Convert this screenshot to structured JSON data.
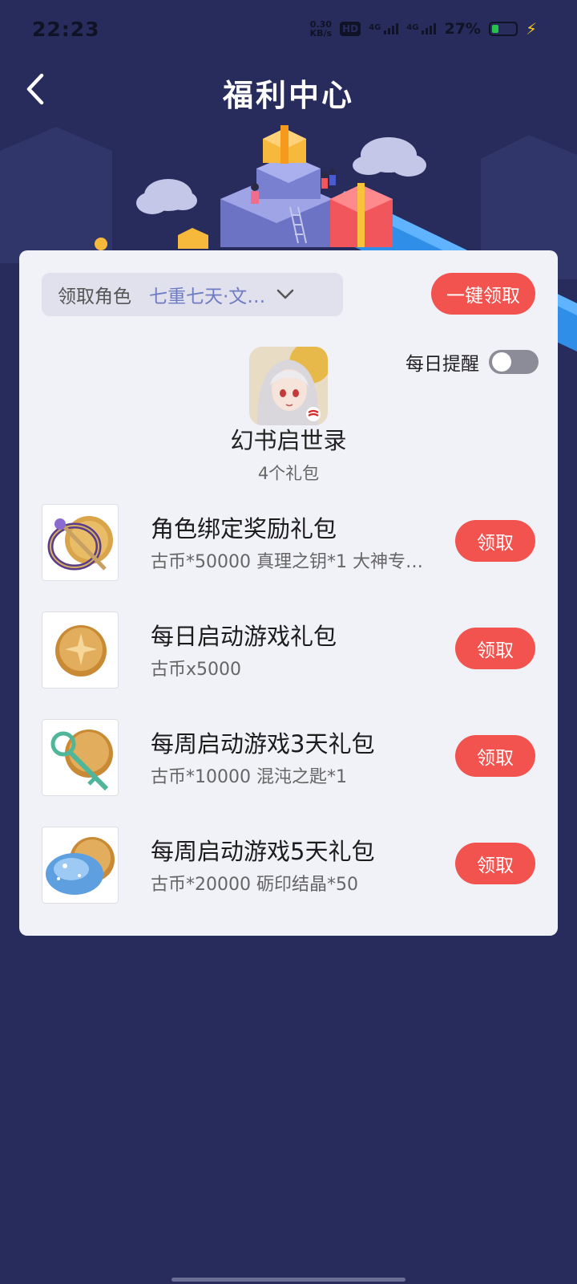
{
  "status_bar": {
    "time": "22:23",
    "net_speed_value": "0.30",
    "net_speed_unit": "KB/s",
    "hd_label": "HD",
    "sim1_label": "4G",
    "sim2_label": "4G",
    "battery_percent": "27%",
    "battery_level": 0.27,
    "battery_color": "#26c24a"
  },
  "header": {
    "title": "福利中心",
    "back_icon": "chevron-left-icon"
  },
  "role": {
    "label": "领取角色",
    "value": "七重七天·文…",
    "dropdown_icon": "chevron-down-icon"
  },
  "claim_all_label": "一键领取",
  "daily_reminder": {
    "label": "每日提醒",
    "enabled": false
  },
  "game": {
    "name": "幻书启世录",
    "pack_count": "4个礼包"
  },
  "packs": [
    {
      "title": "角色绑定奖励礼包",
      "desc": "古币*50000 真理之钥*1 大神专…",
      "button": "领取",
      "icon": "coin-key-ornament-icon"
    },
    {
      "title": "每日启动游戏礼包",
      "desc": "古币x5000",
      "button": "领取",
      "icon": "gold-coin-icon"
    },
    {
      "title": "每周启动游戏3天礼包",
      "desc": "古币*10000 混沌之匙*1",
      "button": "领取",
      "icon": "coin-green-key-icon"
    },
    {
      "title": "每周启动游戏5天礼包",
      "desc": "古币*20000 砺印结晶*50",
      "button": "领取",
      "icon": "coin-blue-crystal-icon"
    }
  ],
  "colors": {
    "background": "#282c5c",
    "accent": "#f2534f",
    "card": "#f1f1f8",
    "role_value": "#6f7bc3"
  }
}
